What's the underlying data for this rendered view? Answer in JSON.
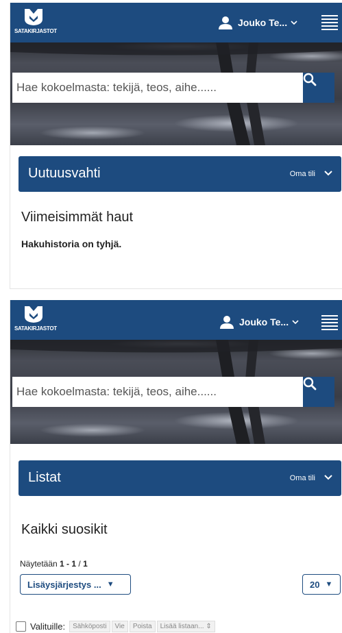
{
  "logo": {
    "text": "SATAKIRJASTOT"
  },
  "user": {
    "name": "Jouko Te..."
  },
  "search": {
    "placeholder": "Hae kokoelmasta: tekijä, teos, aihe......"
  },
  "screen1": {
    "section_title": "Uutuusvahti",
    "section_link": "Oma tili",
    "heading": "Viimeisimmät haut",
    "empty_message": "Hakuhistoria on tyhjä."
  },
  "screen2": {
    "section_title": "Listat",
    "section_link": "Oma tili",
    "heading": "Kaikki suosikit",
    "results_prefix": "Näytetään ",
    "results_range": "1 - 1",
    "results_sep": " / ",
    "results_total": "1",
    "sort_label": "Lisäysjärjestys ...",
    "sort_arrow": "▼",
    "per_page_value": "20",
    "per_page_arrow": "▼",
    "selected_label": "Valituille:",
    "actions": [
      "Sähköposti",
      "Vie",
      "Poista",
      "Lisää listaan... ⇕"
    ]
  },
  "colors": {
    "brand": "#1d4b7f",
    "white": "#ffffff"
  },
  "icons": [
    "logo-icon",
    "user-icon",
    "chevron-down-icon",
    "hamburger-menu-icon",
    "search-icon"
  ]
}
